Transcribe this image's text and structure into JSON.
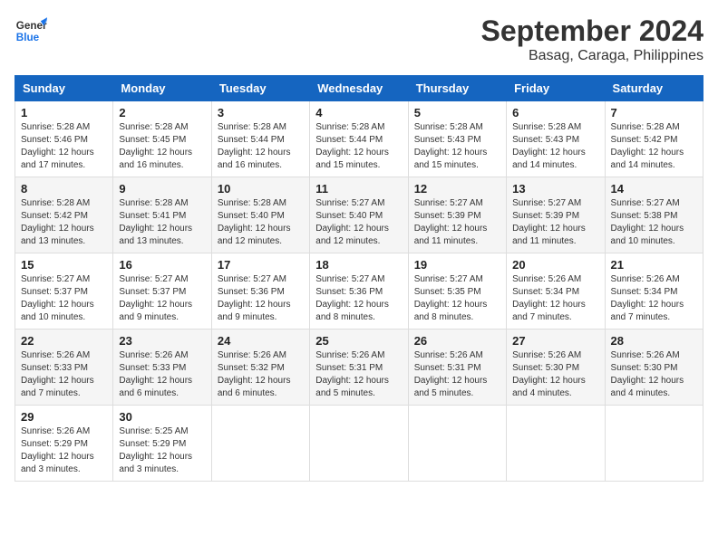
{
  "header": {
    "logo_general": "General",
    "logo_blue": "Blue",
    "title": "September 2024",
    "subtitle": "Basag, Caraga, Philippines"
  },
  "weekdays": [
    "Sunday",
    "Monday",
    "Tuesday",
    "Wednesday",
    "Thursday",
    "Friday",
    "Saturday"
  ],
  "weeks": [
    [
      {
        "day": "1",
        "sunrise": "5:28 AM",
        "sunset": "5:46 PM",
        "daylight": "12 hours and 17 minutes."
      },
      {
        "day": "2",
        "sunrise": "5:28 AM",
        "sunset": "5:45 PM",
        "daylight": "12 hours and 16 minutes."
      },
      {
        "day": "3",
        "sunrise": "5:28 AM",
        "sunset": "5:44 PM",
        "daylight": "12 hours and 16 minutes."
      },
      {
        "day": "4",
        "sunrise": "5:28 AM",
        "sunset": "5:44 PM",
        "daylight": "12 hours and 15 minutes."
      },
      {
        "day": "5",
        "sunrise": "5:28 AM",
        "sunset": "5:43 PM",
        "daylight": "12 hours and 15 minutes."
      },
      {
        "day": "6",
        "sunrise": "5:28 AM",
        "sunset": "5:43 PM",
        "daylight": "12 hours and 14 minutes."
      },
      {
        "day": "7",
        "sunrise": "5:28 AM",
        "sunset": "5:42 PM",
        "daylight": "12 hours and 14 minutes."
      }
    ],
    [
      {
        "day": "8",
        "sunrise": "5:28 AM",
        "sunset": "5:42 PM",
        "daylight": "12 hours and 13 minutes."
      },
      {
        "day": "9",
        "sunrise": "5:28 AM",
        "sunset": "5:41 PM",
        "daylight": "12 hours and 13 minutes."
      },
      {
        "day": "10",
        "sunrise": "5:28 AM",
        "sunset": "5:40 PM",
        "daylight": "12 hours and 12 minutes."
      },
      {
        "day": "11",
        "sunrise": "5:27 AM",
        "sunset": "5:40 PM",
        "daylight": "12 hours and 12 minutes."
      },
      {
        "day": "12",
        "sunrise": "5:27 AM",
        "sunset": "5:39 PM",
        "daylight": "12 hours and 11 minutes."
      },
      {
        "day": "13",
        "sunrise": "5:27 AM",
        "sunset": "5:39 PM",
        "daylight": "12 hours and 11 minutes."
      },
      {
        "day": "14",
        "sunrise": "5:27 AM",
        "sunset": "5:38 PM",
        "daylight": "12 hours and 10 minutes."
      }
    ],
    [
      {
        "day": "15",
        "sunrise": "5:27 AM",
        "sunset": "5:37 PM",
        "daylight": "12 hours and 10 minutes."
      },
      {
        "day": "16",
        "sunrise": "5:27 AM",
        "sunset": "5:37 PM",
        "daylight": "12 hours and 9 minutes."
      },
      {
        "day": "17",
        "sunrise": "5:27 AM",
        "sunset": "5:36 PM",
        "daylight": "12 hours and 9 minutes."
      },
      {
        "day": "18",
        "sunrise": "5:27 AM",
        "sunset": "5:36 PM",
        "daylight": "12 hours and 8 minutes."
      },
      {
        "day": "19",
        "sunrise": "5:27 AM",
        "sunset": "5:35 PM",
        "daylight": "12 hours and 8 minutes."
      },
      {
        "day": "20",
        "sunrise": "5:26 AM",
        "sunset": "5:34 PM",
        "daylight": "12 hours and 7 minutes."
      },
      {
        "day": "21",
        "sunrise": "5:26 AM",
        "sunset": "5:34 PM",
        "daylight": "12 hours and 7 minutes."
      }
    ],
    [
      {
        "day": "22",
        "sunrise": "5:26 AM",
        "sunset": "5:33 PM",
        "daylight": "12 hours and 7 minutes."
      },
      {
        "day": "23",
        "sunrise": "5:26 AM",
        "sunset": "5:33 PM",
        "daylight": "12 hours and 6 minutes."
      },
      {
        "day": "24",
        "sunrise": "5:26 AM",
        "sunset": "5:32 PM",
        "daylight": "12 hours and 6 minutes."
      },
      {
        "day": "25",
        "sunrise": "5:26 AM",
        "sunset": "5:31 PM",
        "daylight": "12 hours and 5 minutes."
      },
      {
        "day": "26",
        "sunrise": "5:26 AM",
        "sunset": "5:31 PM",
        "daylight": "12 hours and 5 minutes."
      },
      {
        "day": "27",
        "sunrise": "5:26 AM",
        "sunset": "5:30 PM",
        "daylight": "12 hours and 4 minutes."
      },
      {
        "day": "28",
        "sunrise": "5:26 AM",
        "sunset": "5:30 PM",
        "daylight": "12 hours and 4 minutes."
      }
    ],
    [
      {
        "day": "29",
        "sunrise": "5:26 AM",
        "sunset": "5:29 PM",
        "daylight": "12 hours and 3 minutes."
      },
      {
        "day": "30",
        "sunrise": "5:25 AM",
        "sunset": "5:29 PM",
        "daylight": "12 hours and 3 minutes."
      },
      null,
      null,
      null,
      null,
      null
    ]
  ]
}
